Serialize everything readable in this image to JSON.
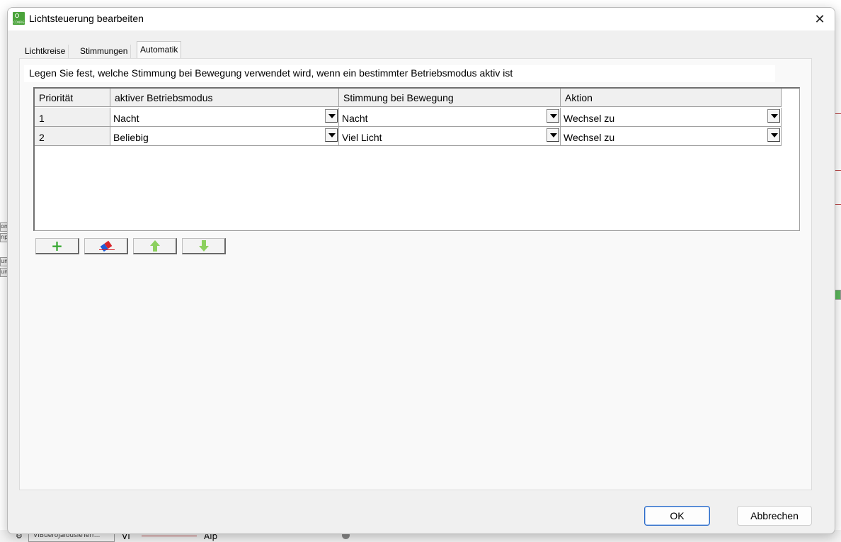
{
  "dialog": {
    "title": "Lichtsteuerung bearbeiten",
    "close_glyph": "✕",
    "icon_text": "CONFIG"
  },
  "tabs": [
    {
      "label": "Lichtkreise",
      "active": false
    },
    {
      "label": "Stimmungen",
      "active": false
    },
    {
      "label": "Automatik",
      "active": true
    }
  ],
  "automatik": {
    "description": "Legen Sie fest, welche Stimmung bei Bewegung verwendet wird, wenn ein bestimmter Betriebsmodus aktiv ist",
    "columns": [
      "Priorität",
      "aktiver Betriebsmodus",
      "Stimmung bei Bewegung",
      "Aktion"
    ],
    "rows": [
      {
        "priority": "1",
        "mode": "Nacht",
        "mood": "Nacht",
        "action": "Wechsel zu"
      },
      {
        "priority": "2",
        "mode": "Beliebig",
        "mood": "Viel Licht",
        "action": "Wechsel zu"
      }
    ],
    "toolbar": {
      "add_glyph": "+",
      "add_icon": "plus-icon",
      "delete_icon": "eraser-icon",
      "up_icon": "arrow-up-icon",
      "down_icon": "arrow-down-icon"
    }
  },
  "buttons": {
    "ok": "OK",
    "cancel": "Abbrechen"
  },
  "background": {
    "left_frag_1": "om",
    "left_frag_2": "npc",
    "left_frag_3": "um",
    "left_frag_4": "um",
    "bottom_item": "VIBueroJalousieTerr...",
    "bottom_vi": "VI",
    "bottom_alp": "Alp"
  },
  "colors": {
    "accent_green": "#3aa935",
    "arrow_green": "#8cd05e",
    "eraser_blue": "#1f5bd7",
    "eraser_red": "#d8232a",
    "primary_border": "#2a6ac8"
  }
}
